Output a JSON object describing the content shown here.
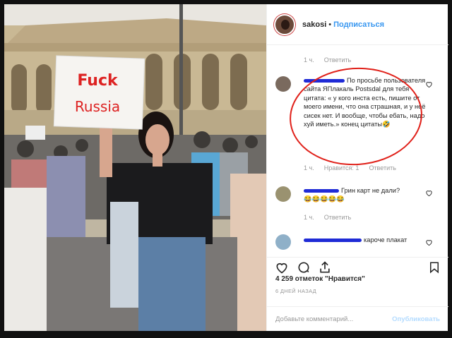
{
  "post": {
    "username": "sakosi",
    "separator": "•",
    "follow_label": "Подписаться",
    "likes": "4 259 отметок \"Нравится\"",
    "time_ago": "6 ДНЕЙ НАЗАД",
    "add_comment_placeholder": "Добавьте комментарий...",
    "publish_label": "Опубликовать"
  },
  "sign": {
    "line1": "Fuck",
    "line2": "Russia"
  },
  "comments": [
    {
      "time": "1 ч.",
      "likes": "",
      "reply": "Ответить"
    },
    {
      "text": "По просьбе пользователя сайта ЯПлакаль Postsdal для тебя цитата: « у кого инста есть, пишите от моего имени, что она страшная, и у неё сисек нет. И вообще, чтобы ебать, надо хуй иметь.» конец цитаты🤣",
      "time": "1 ч.",
      "likes": "Нравится: 1",
      "reply": "Ответить"
    },
    {
      "text": "Грин карт не дали?",
      "emoji": "😂😂😂😂😂",
      "time": "1 ч.",
      "reply": "Ответить"
    },
    {
      "text": "кароче плакат"
    }
  ],
  "colors": {
    "accent": "#3897f0",
    "annotation": "#e0211a",
    "scribble": "#1f2bd6"
  }
}
